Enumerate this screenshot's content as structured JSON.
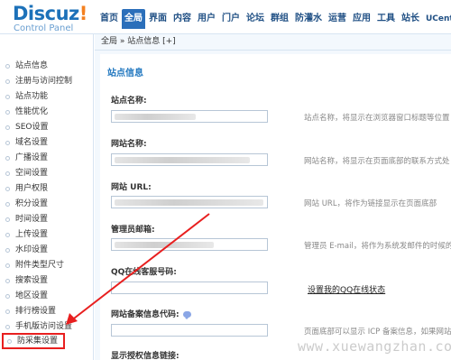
{
  "logo": {
    "main": "Discuz",
    "bang": "!",
    "sub": "Control Panel"
  },
  "nav": [
    "首页",
    "全局",
    "界面",
    "内容",
    "用户",
    "门户",
    "论坛",
    "群组",
    "防灌水",
    "运营",
    "应用",
    "工具",
    "站长",
    "UCenter"
  ],
  "nav_active": "全局",
  "breadcrumb": "全局 » 站点信息 [+]",
  "sidebar": [
    "站点信息",
    "注册与访问控制",
    "站点功能",
    "性能优化",
    "SEO设置",
    "域名设置",
    "广播设置",
    "空间设置",
    "用户权限",
    "积分设置",
    "时间设置",
    "上传设置",
    "水印设置",
    "附件类型尺寸",
    "搜索设置",
    "地区设置",
    "排行榜设置",
    "手机版访问设置",
    "防采集设置"
  ],
  "sidebar_selected": "防采集设置",
  "form": {
    "title": "站点信息",
    "fields": [
      {
        "label": "站点名称:",
        "hint": "站点名称，将显示在浏览器窗口标题等位置"
      },
      {
        "label": "网站名称:",
        "hint": "网站名称，将显示在页面底部的联系方式处"
      },
      {
        "label": "网站 URL:",
        "hint": "网站 URL，将作为链接显示在页面底部"
      },
      {
        "label": "管理员邮箱:",
        "hint": "管理员 E-mail，将作为系统发邮件的时候的发"
      },
      {
        "label": "QQ在线客服号码:",
        "link": "设置我的QQ在线状态"
      },
      {
        "label": "网站备案信息代码:",
        "hint": "页面底部可以显示 ICP 备案信息，如果网站已"
      },
      {
        "label": "显示授权信息链接:"
      }
    ]
  },
  "watermark": "www.xuewangzhan.com",
  "colors": {
    "brand": "#1c71b9",
    "accent": "#f4801f",
    "highlight": "#e81f1f"
  }
}
